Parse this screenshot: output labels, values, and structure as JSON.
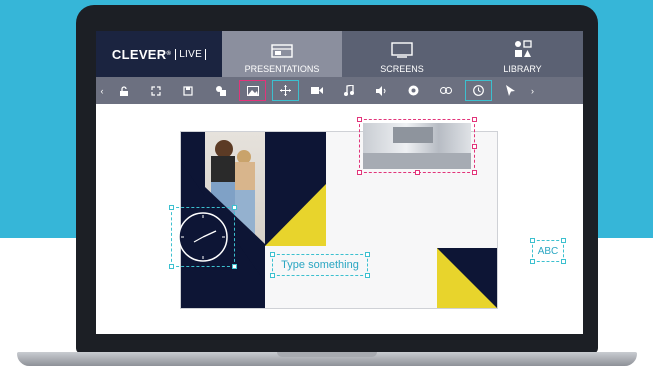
{
  "app": {
    "brand_name": "CLEVER",
    "brand_reg": "®",
    "brand_live": "LIVE"
  },
  "tabs": [
    {
      "label": "PRESENTATIONS",
      "active": true,
      "icon": "presentation-icon"
    },
    {
      "label": "SCREENS",
      "active": false,
      "icon": "monitor-icon"
    },
    {
      "label": "LIBRARY",
      "active": false,
      "icon": "library-icon"
    }
  ],
  "toolbar": {
    "left_arrow": "‹",
    "right_arrow": "›",
    "tools": [
      {
        "name": "unlock-icon"
      },
      {
        "name": "fullscreen-icon"
      },
      {
        "name": "save-icon"
      },
      {
        "name": "shapes-icon"
      },
      {
        "name": "image-icon",
        "selected": "pink"
      },
      {
        "name": "move-icon",
        "selected": "cyan"
      },
      {
        "name": "video-icon"
      },
      {
        "name": "music-icon"
      },
      {
        "name": "volume-icon"
      },
      {
        "name": "chrome-icon"
      },
      {
        "name": "link-icon"
      },
      {
        "name": "clock-icon",
        "selected": "cyan"
      },
      {
        "name": "pointer-icon"
      }
    ]
  },
  "canvas": {
    "text_element": "Type something",
    "floating_text": "ABC"
  },
  "colors": {
    "navy": "#0d1535",
    "yellow": "#e8d42c",
    "pink": "#e2347a",
    "cyan": "#3cc0cf",
    "background_band": "#36b6d8"
  }
}
